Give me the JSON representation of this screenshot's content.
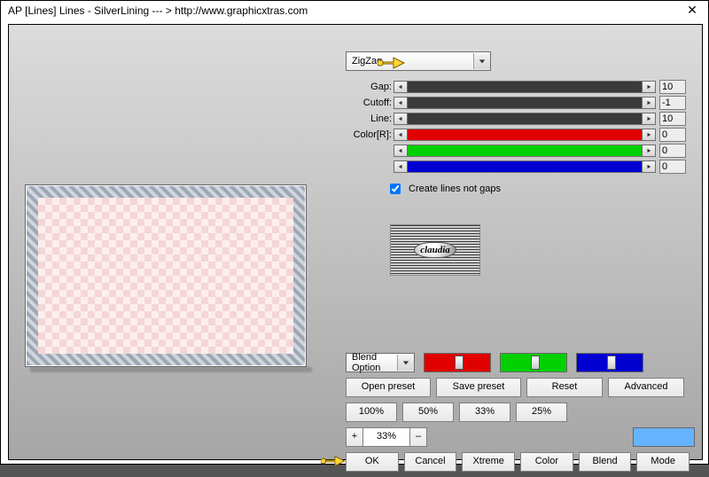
{
  "window": {
    "title": "AP [Lines]  Lines - SilverLining    --- >  http://www.graphicxtras.com"
  },
  "preset_dropdown": {
    "selected": "ZigZag"
  },
  "params": {
    "gap": {
      "label": "Gap:",
      "value": "10"
    },
    "cutoff": {
      "label": "Cutoff:",
      "value": "-1"
    },
    "line": {
      "label": "Line:",
      "value": "10"
    },
    "colorR": {
      "label": "Color[R]:",
      "r": "0",
      "g": "0",
      "b": "0"
    }
  },
  "checkbox": {
    "label": "Create lines not gaps",
    "checked": true
  },
  "logo": {
    "text": "claudia"
  },
  "blend_option": {
    "label": "Blend Option"
  },
  "buttons": {
    "open_preset": "Open preset",
    "save_preset": "Save preset",
    "reset": "Reset",
    "advanced": "Advanced",
    "p100": "100%",
    "p50": "50%",
    "p33": "33%",
    "p25": "25%",
    "plus": "+",
    "minus": "–",
    "ok": "OK",
    "cancel": "Cancel",
    "xtreme": "Xtreme",
    "color": "Color",
    "blend": "Blend",
    "mode": "Mode"
  },
  "zoom": {
    "value": "33%"
  },
  "swatch_color": "#66b3ff"
}
